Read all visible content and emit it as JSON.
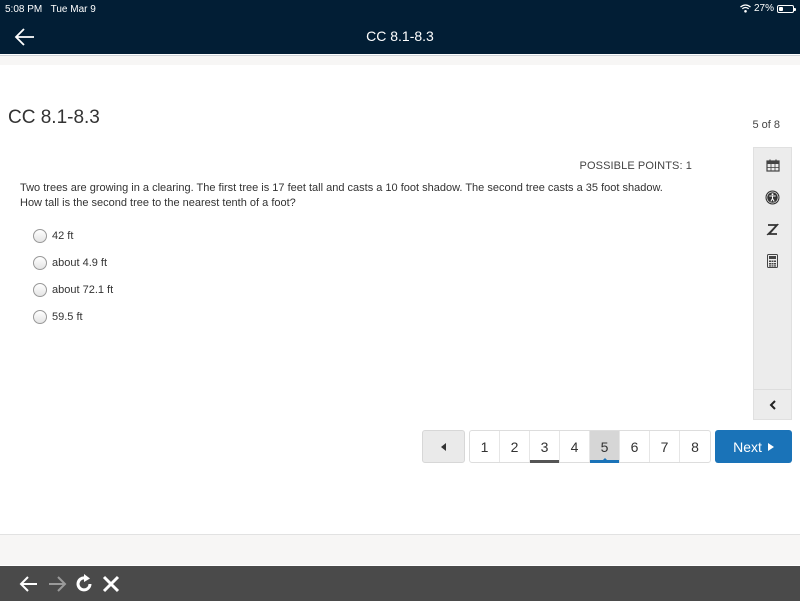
{
  "status_bar": {
    "time": "5:08 PM",
    "date": "Tue Mar 9",
    "battery_percent_label": "27%",
    "battery_level": 0.27,
    "icons": [
      "wifi-icon",
      "battery-icon"
    ]
  },
  "nav_bar": {
    "title": "CC 8.1-8.3",
    "back_icon": "arrow-left-icon"
  },
  "assessment": {
    "title": "CC 8.1-8.3",
    "question_position": "5 of 8"
  },
  "question": {
    "possible_points": "POSSIBLE POINTS: 1",
    "text_line1": "Two trees are growing in a clearing. The first tree is 17 feet tall and casts a 10 foot shadow. The second tree casts a 35 foot shadow.",
    "text_line2": "How tall is the second tree to the nearest tenth of a foot?",
    "answers": [
      {
        "label": "42 ft",
        "selected": false
      },
      {
        "label": "about 4.9 ft",
        "selected": false
      },
      {
        "label": "about 72.1 ft",
        "selected": false
      },
      {
        "label": "59.5 ft",
        "selected": false
      }
    ]
  },
  "toolbar": {
    "tools": [
      "calendar-icon",
      "accessibility-icon",
      "no-pencil-icon",
      "calculator-icon"
    ],
    "collapse_icon": "chevron-left-icon"
  },
  "pagination": {
    "prev_icon": "triangle-left-icon",
    "pages": [
      "1",
      "2",
      "3",
      "4",
      "5",
      "6",
      "7",
      "8"
    ],
    "current_page": "5",
    "visited_pages": [
      "3"
    ],
    "next_label": "Next",
    "next_icon": "triangle-right-icon"
  },
  "browser_bar": {
    "buttons": [
      "back-arrow-icon",
      "forward-arrow-icon",
      "reload-icon",
      "close-icon"
    ]
  }
}
